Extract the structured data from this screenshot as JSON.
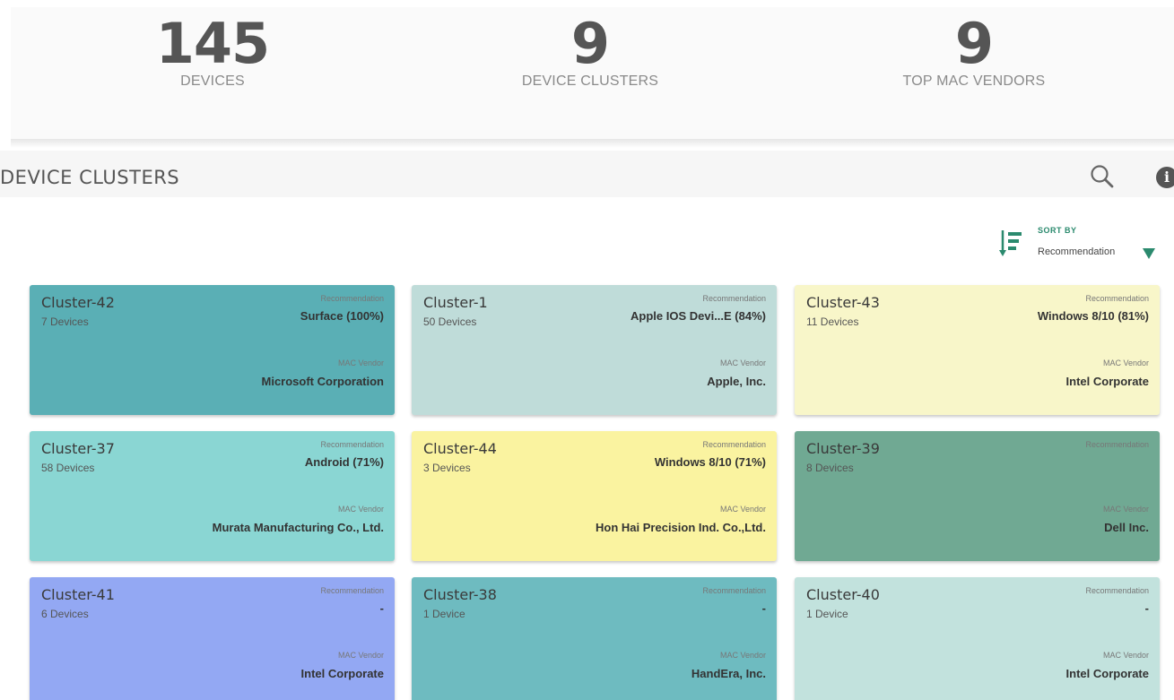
{
  "stats": [
    {
      "value": "145",
      "label": "DEVICES"
    },
    {
      "value": "9",
      "label": "DEVICE CLUSTERS"
    },
    {
      "value": "9",
      "label": "TOP MAC VENDORS"
    }
  ],
  "section": {
    "title": "DEVICE CLUSTERS",
    "search_icon": "search-icon",
    "info_icon": "info-icon",
    "info_glyph": "i"
  },
  "sort": {
    "label": "SORT BY",
    "value": "Recommendation",
    "icon": "sort-descending-icon"
  },
  "clusters": [
    {
      "name": "Cluster-42",
      "devices": "7 Devices",
      "rec_label": "Recommendation",
      "recommendation": "Surface (100%)",
      "mac_label": "MAC Vendor",
      "mac_vendor": "Microsoft Corporation",
      "color": "#5aafb5"
    },
    {
      "name": "Cluster-1",
      "devices": "50 Devices",
      "rec_label": "Recommendation",
      "recommendation": "Apple IOS Devi...E (84%)",
      "mac_label": "MAC Vendor",
      "mac_vendor": "Apple, Inc.",
      "color": "#bfdcd9"
    },
    {
      "name": "Cluster-43",
      "devices": "11 Devices",
      "rec_label": "Recommendation",
      "recommendation": "Windows 8/10 (81%)",
      "mac_label": "MAC Vendor",
      "mac_vendor": "Intel Corporate",
      "color": "#f8f6c9"
    },
    {
      "name": "Cluster-37",
      "devices": "58 Devices",
      "rec_label": "Recommendation",
      "recommendation": "Android (71%)",
      "mac_label": "MAC Vendor",
      "mac_vendor": "Murata Manufacturing Co., Ltd.",
      "color": "#8ad6d3"
    },
    {
      "name": "Cluster-44",
      "devices": "3 Devices",
      "rec_label": "Recommendation",
      "recommendation": "Windows 8/10 (71%)",
      "mac_label": "MAC Vendor",
      "mac_vendor": "Hon Hai Precision Ind. Co.,Ltd.",
      "color": "#faf3a0"
    },
    {
      "name": "Cluster-39",
      "devices": "8 Devices",
      "rec_label": "Recommendation",
      "recommendation": "",
      "mac_label": "MAC Vendor",
      "mac_vendor": "Dell Inc.",
      "color": "#70a993"
    },
    {
      "name": "Cluster-41",
      "devices": "6 Devices",
      "rec_label": "Recommendation",
      "recommendation": "-",
      "mac_label": "MAC Vendor",
      "mac_vendor": "Intel Corporate",
      "color": "#93a8f3"
    },
    {
      "name": "Cluster-38",
      "devices": "1 Device",
      "rec_label": "Recommendation",
      "recommendation": "-",
      "mac_label": "MAC Vendor",
      "mac_vendor": "HandEra, Inc.",
      "color": "#6ebbc0"
    },
    {
      "name": "Cluster-40",
      "devices": "1 Device",
      "rec_label": "Recommendation",
      "recommendation": "-",
      "mac_label": "MAC Vendor",
      "mac_vendor": "Intel Corporate",
      "color": "#c2e2dd"
    }
  ]
}
